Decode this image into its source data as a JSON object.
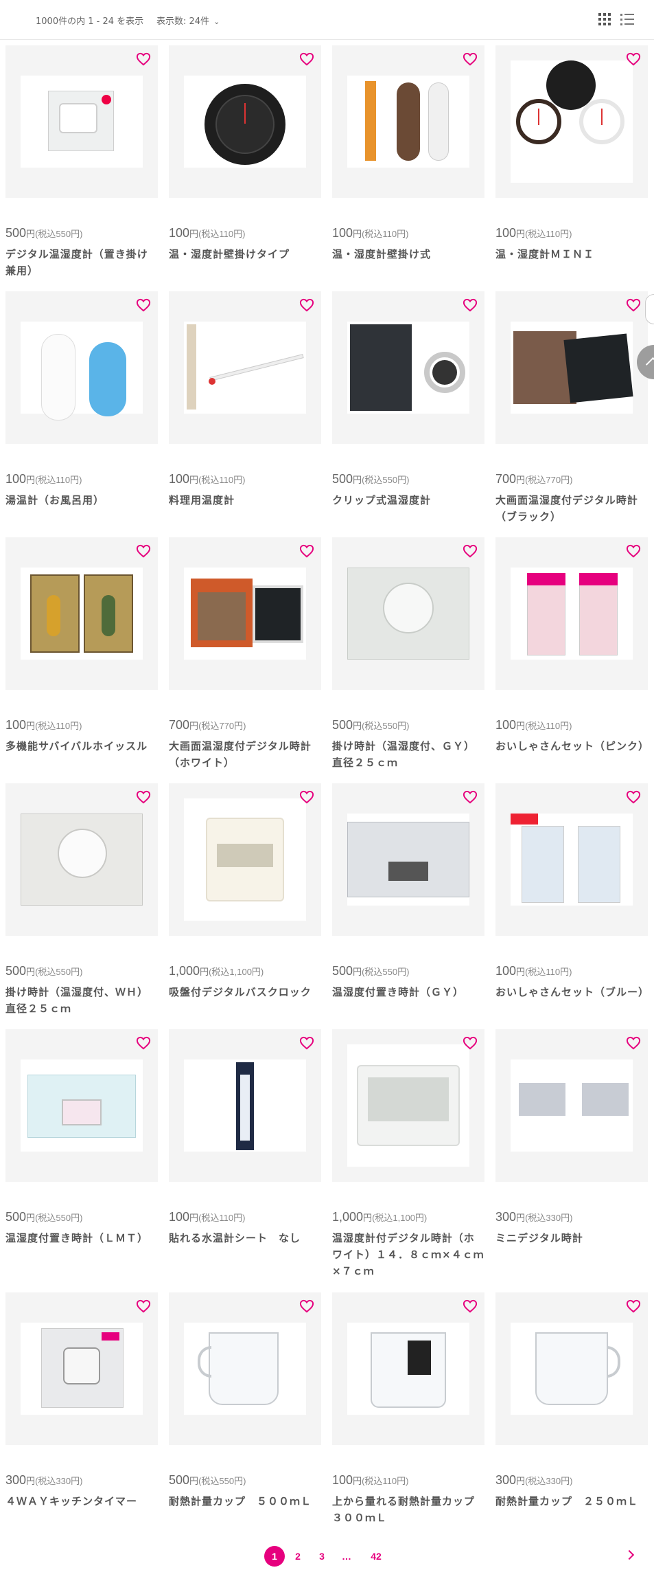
{
  "toolbar": {
    "result_count": "1000件の内 1 - 24 を表示",
    "per_page_label": "表示数: 24件"
  },
  "colors": {
    "accent": "#e6007e",
    "card_bg": "#f4f4f4"
  },
  "products": [
    {
      "price": "500",
      "yen": "円",
      "tax": "(税込550円)",
      "name": "デジタル温湿度計（置き掛け兼用）"
    },
    {
      "price": "100",
      "yen": "円",
      "tax": "(税込110円)",
      "name": "温・湿度計壁掛けタイプ"
    },
    {
      "price": "100",
      "yen": "円",
      "tax": "(税込110円)",
      "name": "温・湿度計壁掛け式"
    },
    {
      "price": "100",
      "yen": "円",
      "tax": "(税込110円)",
      "name": "温・湿度計ＭＩＮＩ"
    },
    {
      "price": "100",
      "yen": "円",
      "tax": "(税込110円)",
      "name": "湯温計（お風呂用）"
    },
    {
      "price": "100",
      "yen": "円",
      "tax": "(税込110円)",
      "name": "料理用温度計"
    },
    {
      "price": "500",
      "yen": "円",
      "tax": "(税込550円)",
      "name": "クリップ式温湿度計"
    },
    {
      "price": "700",
      "yen": "円",
      "tax": "(税込770円)",
      "name": "大画面温湿度付デジタル時計（ブラック）"
    },
    {
      "price": "100",
      "yen": "円",
      "tax": "(税込110円)",
      "name": "多機能サバイバルホイッスル"
    },
    {
      "price": "700",
      "yen": "円",
      "tax": "(税込770円)",
      "name": "大画面温湿度付デジタル時計（ホワイト）"
    },
    {
      "price": "500",
      "yen": "円",
      "tax": "(税込550円)",
      "name": "掛け時計（温湿度付、ＧＹ）直径２５ｃｍ"
    },
    {
      "price": "100",
      "yen": "円",
      "tax": "(税込110円)",
      "name": "おいしゃさんセット（ピンク）"
    },
    {
      "price": "500",
      "yen": "円",
      "tax": "(税込550円)",
      "name": "掛け時計（温湿度付、ＷＨ）直径２５ｃｍ"
    },
    {
      "price": "1,000",
      "yen": "円",
      "tax": "(税込1,100円)",
      "name": "吸盤付デジタルバスクロック"
    },
    {
      "price": "500",
      "yen": "円",
      "tax": "(税込550円)",
      "name": "温湿度付置き時計（ＧＹ）"
    },
    {
      "price": "100",
      "yen": "円",
      "tax": "(税込110円)",
      "name": "おいしゃさんセット（ブルー）"
    },
    {
      "price": "500",
      "yen": "円",
      "tax": "(税込550円)",
      "name": "温湿度付置き時計（ＬＭＴ）"
    },
    {
      "price": "100",
      "yen": "円",
      "tax": "(税込110円)",
      "name": "貼れる水温計シート　なし"
    },
    {
      "price": "1,000",
      "yen": "円",
      "tax": "(税込1,100円)",
      "name": "温湿度計付デジタル時計（ホワイト）１４．８ｃｍ×４ｃｍ×７ｃｍ"
    },
    {
      "price": "300",
      "yen": "円",
      "tax": "(税込330円)",
      "name": "ミニデジタル時計"
    },
    {
      "price": "300",
      "yen": "円",
      "tax": "(税込330円)",
      "name": "４ＷＡＹキッチンタイマー"
    },
    {
      "price": "500",
      "yen": "円",
      "tax": "(税込550円)",
      "name": "耐熱計量カップ　５００ｍＬ"
    },
    {
      "price": "100",
      "yen": "円",
      "tax": "(税込110円)",
      "name": "上から量れる耐熱計量カップ３００ｍＬ"
    },
    {
      "price": "300",
      "yen": "円",
      "tax": "(税込330円)",
      "name": "耐熱計量カップ　２５０ｍＬ"
    }
  ],
  "pagination": {
    "pages": [
      "1",
      "2",
      "3",
      "…",
      "42"
    ],
    "current": "1"
  }
}
